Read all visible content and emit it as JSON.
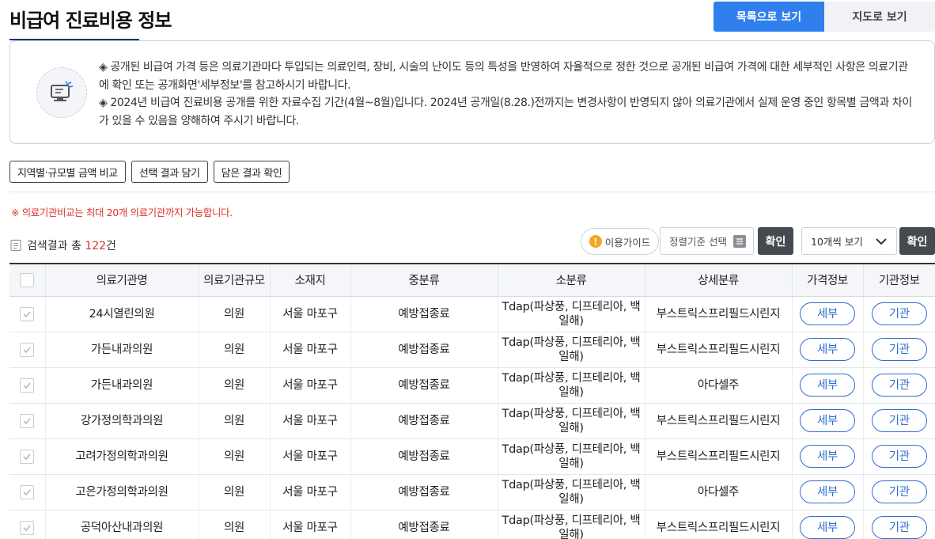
{
  "page": {
    "title": "비급여 진료비용 정보",
    "view_list_label": "목록으로 보기",
    "view_map_label": "지도로 보기"
  },
  "notice": {
    "icon": "monitor-icon",
    "line1": "◈ 공개된 비급여 가격 등은 의료기관마다 투입되는 의료인력, 장비, 시술의 난이도 등의 특성을 반영하여 자율적으로 정한 것으로 공개된 비급여 가격에 대한 세부적인 사항은 의료기관에 확인 또는 공개화면'세부정보'를 참고하시기 바랍니다.",
    "line2": "◈ 2024년 비급여 진료비용 공개를 위한 자료수집 기간(4월~8월)입니다. 2024년 공개일(8.28.)전까지는 변경사항이 반영되지 않아 의료기관에서 실제 운영 중인 항목별 금액과 차이가 있을 수 있음을 양해하여 주시기 바랍니다."
  },
  "actions": {
    "compare": "지역별·규모별 금액 비교",
    "add_selected": "선택 결과 담기",
    "view_saved": "담은 결과 확인"
  },
  "limit_note": "※ 의료기관비교는 최대 20개 의료기관까지 가능합니다.",
  "results": {
    "prefix": "검색결과 총 ",
    "count": "122",
    "suffix": "건"
  },
  "toolbar": {
    "guide": "이용가이드",
    "sort_placeholder": "정렬기준 선택",
    "confirm": "확인",
    "per_page": "10개씩 보기",
    "confirm2": "확인"
  },
  "table": {
    "headers": [
      "의료기관명",
      "의료기관규모",
      "소재지",
      "중분류",
      "소분류",
      "상세분류",
      "가격정보",
      "기관정보"
    ],
    "detail_label": "세부",
    "org_label": "기관",
    "rows": [
      {
        "name": "24시열린의원",
        "size": "의원",
        "loc": "서울 마포구",
        "mid": "예방접종료",
        "sub": "Tdap(파상풍, 디프테리아, 백일해)",
        "detail": "부스트릭스프리필드시린지"
      },
      {
        "name": "가든내과의원",
        "size": "의원",
        "loc": "서울 마포구",
        "mid": "예방접종료",
        "sub": "Tdap(파상풍, 디프테리아, 백일해)",
        "detail": "부스트릭스프리필드시린지"
      },
      {
        "name": "가든내과의원",
        "size": "의원",
        "loc": "서울 마포구",
        "mid": "예방접종료",
        "sub": "Tdap(파상풍, 디프테리아, 백일해)",
        "detail": "아다셀주"
      },
      {
        "name": "강가정의학과의원",
        "size": "의원",
        "loc": "서울 마포구",
        "mid": "예방접종료",
        "sub": "Tdap(파상풍, 디프테리아, 백일해)",
        "detail": "부스트릭스프리필드시린지"
      },
      {
        "name": "고려가정의학과의원",
        "size": "의원",
        "loc": "서울 마포구",
        "mid": "예방접종료",
        "sub": "Tdap(파상풍, 디프테리아, 백일해)",
        "detail": "부스트릭스프리필드시린지"
      },
      {
        "name": "고은가정의학과의원",
        "size": "의원",
        "loc": "서울 마포구",
        "mid": "예방접종료",
        "sub": "Tdap(파상풍, 디프테리아, 백일해)",
        "detail": "아다셀주"
      },
      {
        "name": "공덕아산내과의원",
        "size": "의원",
        "loc": "서울 마포구",
        "mid": "예방접종료",
        "sub": "Tdap(파상풍, 디프테리아, 백일해)",
        "detail": "부스트릭스프리필드시린지"
      }
    ]
  }
}
